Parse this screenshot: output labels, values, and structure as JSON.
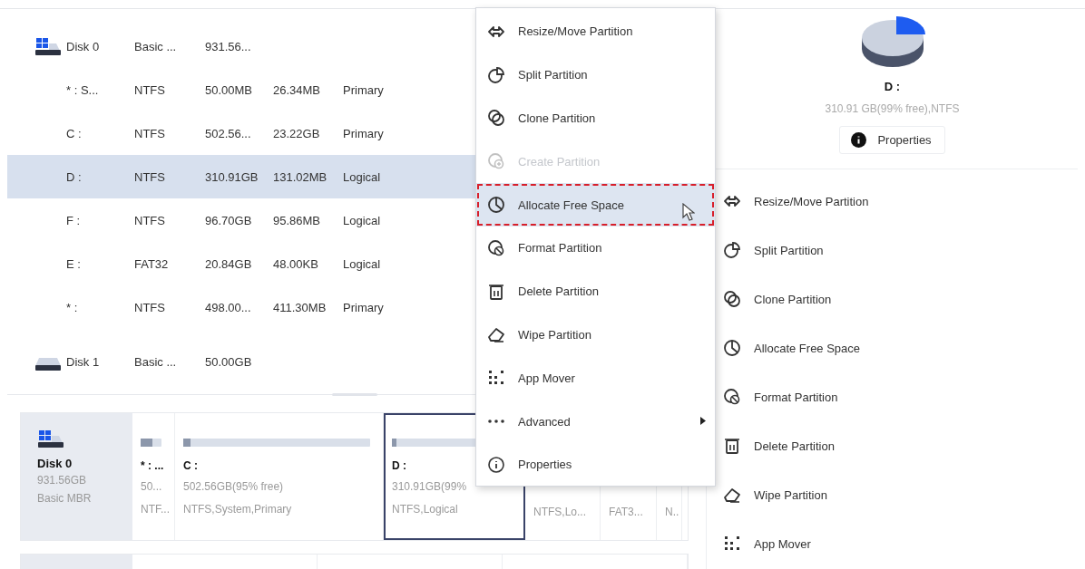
{
  "partition_table": {
    "rows": [
      {
        "kind": "system_disk",
        "name": "Disk 0",
        "cells": [
          "Basic ...",
          "931.56..."
        ],
        "selected": false
      },
      {
        "kind": "partition",
        "name": "* : S...",
        "cells": [
          "NTFS",
          "50.00MB",
          "26.34MB",
          "Primary"
        ],
        "selected": false
      },
      {
        "kind": "partition",
        "name": "C :",
        "cells": [
          "NTFS",
          "502.56...",
          "23.22GB",
          "Primary"
        ],
        "selected": false
      },
      {
        "kind": "partition",
        "name": "D :",
        "cells": [
          "NTFS",
          "310.91GB",
          "131.02MB",
          "Logical"
        ],
        "selected": true
      },
      {
        "kind": "partition",
        "name": "F :",
        "cells": [
          "NTFS",
          "96.70GB",
          "95.86MB",
          "Logical"
        ],
        "selected": false
      },
      {
        "kind": "partition",
        "name": "E :",
        "cells": [
          "FAT32",
          "20.84GB",
          "48.00KB",
          "Logical"
        ],
        "selected": false
      },
      {
        "kind": "partition",
        "name": "* :",
        "cells": [
          "NTFS",
          "498.00...",
          "411.30MB",
          "Primary"
        ],
        "selected": false
      },
      {
        "kind": "data_disk",
        "name": "Disk 1",
        "cells": [
          "Basic ...",
          "50.00GB"
        ],
        "selected": false
      }
    ]
  },
  "disk_map": {
    "disks": [
      {
        "kind": "system_disk",
        "name": "Disk 0",
        "size": "931.56GB",
        "style": "Basic MBR",
        "partitions": [
          {
            "label": "* : ...",
            "size": "50...",
            "info": "NTF...",
            "level": 0.55,
            "selected": false
          },
          {
            "label": "C :",
            "size": "502.56GB(95% free)",
            "info": "NTFS,System,Primary",
            "level": 0.04,
            "selected": false
          },
          {
            "label": "D :",
            "size": "310.91GB(99%",
            "info": "NTFS,Logical",
            "level": 0.01,
            "selected": true
          },
          {
            "info": "NTFS,Lo...",
            "selected": false
          },
          {
            "info": "FAT3...",
            "selected": false
          },
          {
            "info": "N..",
            "selected": false
          }
        ]
      },
      {
        "partitions": [
          {
            "selected": false
          },
          {
            "selected": false
          },
          {
            "selected": false
          }
        ]
      }
    ]
  },
  "details": {
    "name": "D :",
    "summary": "310.91 GB(99% free),NTFS",
    "properties_button": "Properties",
    "actions": [
      {
        "kind": "resize",
        "label": "Resize/Move Partition"
      },
      {
        "kind": "split",
        "label": "Split Partition"
      },
      {
        "kind": "clone",
        "label": "Clone Partition"
      },
      {
        "kind": "allocate",
        "label": "Allocate Free Space"
      },
      {
        "kind": "format",
        "label": "Format Partition"
      },
      {
        "kind": "delete",
        "label": "Delete Partition"
      },
      {
        "kind": "wipe",
        "label": "Wipe Partition"
      },
      {
        "kind": "mover",
        "label": "App Mover"
      }
    ]
  },
  "context_menu": {
    "items": [
      {
        "kind": "resize",
        "label": "Resize/Move Partition",
        "disabled": false,
        "selected": false,
        "submenu": false
      },
      {
        "kind": "split",
        "label": "Split Partition",
        "disabled": false,
        "selected": false,
        "submenu": false
      },
      {
        "kind": "clone",
        "label": "Clone Partition",
        "disabled": false,
        "selected": false,
        "submenu": false
      },
      {
        "kind": "create",
        "label": "Create Partition",
        "disabled": true,
        "selected": false,
        "submenu": false
      },
      {
        "kind": "allocate",
        "label": "Allocate Free Space",
        "disabled": false,
        "selected": true,
        "submenu": false
      },
      {
        "kind": "format",
        "label": "Format Partition",
        "disabled": false,
        "selected": false,
        "submenu": false
      },
      {
        "kind": "delete",
        "label": "Delete Partition",
        "disabled": false,
        "selected": false,
        "submenu": false
      },
      {
        "kind": "wipe",
        "label": "Wipe Partition",
        "disabled": false,
        "selected": false,
        "submenu": false
      },
      {
        "kind": "mover",
        "label": "App Mover",
        "disabled": false,
        "selected": false,
        "submenu": false
      },
      {
        "kind": "advanced",
        "label": "Advanced",
        "disabled": false,
        "selected": false,
        "submenu": true
      },
      {
        "kind": "properties",
        "label": "Properties",
        "disabled": false,
        "selected": false,
        "submenu": false
      }
    ]
  }
}
